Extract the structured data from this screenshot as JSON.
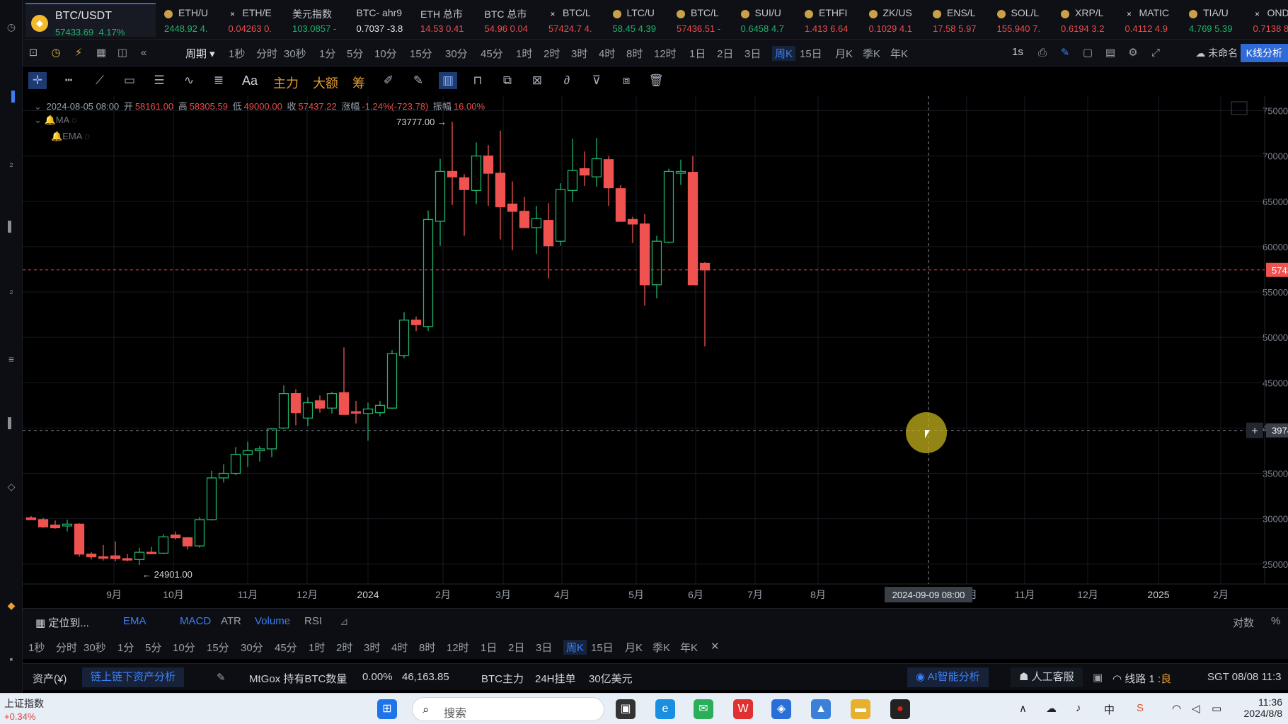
{
  "ticker": {
    "main": {
      "name": "BTC/USDT",
      "price": "57433.69",
      "change": "4.17%"
    },
    "items": [
      {
        "name": "ETH/U",
        "value": "2448.92",
        "change": "4.",
        "dir": "up",
        "icon": "coin-icon"
      },
      {
        "name": "ETH/E",
        "value": "0.04263",
        "change": "0.",
        "dir": "dn",
        "icon": "x-icon"
      },
      {
        "name": "美元指数",
        "value": "103.0857",
        "change": "-",
        "dir": "up",
        "icon": ""
      },
      {
        "name": "BTC- ahr9",
        "value": "0.7037",
        "change": "-3.8",
        "dir": "wh",
        "icon": ""
      },
      {
        "name": "ETH 总市",
        "value": "14.53",
        "change": "0.41",
        "dir": "dn",
        "icon": ""
      },
      {
        "name": "BTC 总市",
        "value": "54.96",
        "change": "0.04",
        "dir": "dn",
        "icon": ""
      },
      {
        "name": "BTC/L",
        "value": "57424.7",
        "change": "4.",
        "dir": "dn",
        "icon": "x-icon"
      },
      {
        "name": "LTC/U",
        "value": "58.45",
        "change": "4.39",
        "dir": "up",
        "icon": "coin-icon"
      },
      {
        "name": "BTC/L",
        "value": "57436.51",
        "change": "-",
        "dir": "dn",
        "icon": "coin-icon"
      },
      {
        "name": "SUI/U",
        "value": "0.6458",
        "change": "4.7",
        "dir": "up",
        "icon": "coin-icon"
      },
      {
        "name": "ETHFI",
        "value": "1.413",
        "change": "6.64",
        "dir": "dn",
        "icon": "coin-icon"
      },
      {
        "name": "ZK/US",
        "value": "0.1029",
        "change": "4.1",
        "dir": "dn",
        "icon": "coin-icon"
      },
      {
        "name": "ENS/L",
        "value": "17.58",
        "change": "5.97",
        "dir": "dn",
        "icon": "coin-icon"
      },
      {
        "name": "SOL/L",
        "value": "155.940",
        "change": "7.",
        "dir": "dn",
        "icon": "coin-icon"
      },
      {
        "name": "XRP/L",
        "value": "0.6194",
        "change": "3.2",
        "dir": "dn",
        "icon": "coin-icon"
      },
      {
        "name": "MATIC",
        "value": "0.4112",
        "change": "4.9",
        "dir": "dn",
        "icon": "x-icon"
      },
      {
        "name": "TIA/U",
        "value": "4.769",
        "change": "5.39",
        "dir": "up",
        "icon": "coin-icon"
      },
      {
        "name": "OND",
        "value": "0.7138",
        "change": "8.",
        "dir": "dn",
        "icon": "x-icon"
      }
    ]
  },
  "period_bar": {
    "period_label": "周期",
    "periods": [
      "1秒",
      "分时",
      "30秒",
      "1分",
      "5分",
      "10分",
      "15分",
      "30分",
      "45分",
      "1时",
      "2时",
      "3时",
      "4时",
      "8时",
      "12时",
      "1日",
      "2日",
      "3日",
      "周K",
      "15日",
      "月K",
      "季K",
      "年K"
    ],
    "active": "周K",
    "interval": "1s",
    "layout_name": "未命名",
    "k_button": "K线分析"
  },
  "draw_bar": {
    "text_tool": "Aa",
    "main_force": "主力",
    "large_order": "大额",
    "chips": "筹"
  },
  "info": {
    "date": "2024-08-05 08:00",
    "open_label": "开",
    "open": "58161.00",
    "high_label": "高",
    "high": "58305.59",
    "low_label": "低",
    "low": "49000.00",
    "close_label": "收",
    "close": "57437.22",
    "chg_label": "涨幅",
    "chg": "-1.24%(-723.78)",
    "amp_label": "振幅",
    "amp": "16.00%",
    "ind1": "MA",
    "ind2": "EMA"
  },
  "chart_data": {
    "type": "candlestick",
    "symbol": "BTC/USDT",
    "interval": "周K",
    "yaxis_ticks": [
      25000,
      30000,
      35000,
      40000,
      45000,
      50000,
      55000,
      60000,
      65000,
      70000,
      75000
    ],
    "ylim": [
      22500,
      77500
    ],
    "xaxis_labels": [
      "9月",
      "10月",
      "11月",
      "12月",
      "2024",
      "2月",
      "3月",
      "4月",
      "5月",
      "6月",
      "7月",
      "8月",
      "10月",
      "11月",
      "12月",
      "2025",
      "2月"
    ],
    "high_annotation": "73777.00",
    "low_annotation": "24901.00",
    "last_price_label": "5743",
    "crosshair_price_label": "3974",
    "crosshair_date_label": "2024-09-09 08:00",
    "candles": [
      {
        "o": 30100,
        "h": 30300,
        "l": 29900,
        "c": 29900
      },
      {
        "o": 29900,
        "h": 30100,
        "l": 29000,
        "c": 29100
      },
      {
        "o": 29300,
        "h": 29800,
        "l": 28900,
        "c": 29000
      },
      {
        "o": 29200,
        "h": 29900,
        "l": 28600,
        "c": 29400
      },
      {
        "o": 29400,
        "h": 29500,
        "l": 25800,
        "c": 26100
      },
      {
        "o": 26100,
        "h": 26300,
        "l": 25500,
        "c": 25800
      },
      {
        "o": 25800,
        "h": 27100,
        "l": 25400,
        "c": 25700
      },
      {
        "o": 25900,
        "h": 27500,
        "l": 25300,
        "c": 25600
      },
      {
        "o": 25600,
        "h": 26100,
        "l": 25300,
        "c": 25500
      },
      {
        "o": 25500,
        "h": 26800,
        "l": 24901,
        "c": 26300
      },
      {
        "o": 26300,
        "h": 26900,
        "l": 26100,
        "c": 26200
      },
      {
        "o": 26200,
        "h": 28300,
        "l": 26100,
        "c": 28000
      },
      {
        "o": 28200,
        "h": 28600,
        "l": 27700,
        "c": 27900
      },
      {
        "o": 27900,
        "h": 28000,
        "l": 26600,
        "c": 27000
      },
      {
        "o": 27000,
        "h": 30200,
        "l": 26800,
        "c": 29900
      },
      {
        "o": 29900,
        "h": 35300,
        "l": 29800,
        "c": 34500
      },
      {
        "o": 34500,
        "h": 36000,
        "l": 34000,
        "c": 35000
      },
      {
        "o": 35000,
        "h": 37900,
        "l": 34800,
        "c": 37100
      },
      {
        "o": 37100,
        "h": 38500,
        "l": 35700,
        "c": 37500
      },
      {
        "o": 37500,
        "h": 38000,
        "l": 36300,
        "c": 37700
      },
      {
        "o": 37700,
        "h": 40000,
        "l": 36800,
        "c": 39900
      },
      {
        "o": 40000,
        "h": 44700,
        "l": 39900,
        "c": 43800
      },
      {
        "o": 43800,
        "h": 44300,
        "l": 40300,
        "c": 41700
      },
      {
        "o": 41100,
        "h": 43400,
        "l": 40200,
        "c": 42800
      },
      {
        "o": 43000,
        "h": 43600,
        "l": 41700,
        "c": 42200
      },
      {
        "o": 42200,
        "h": 44000,
        "l": 41600,
        "c": 43800
      },
      {
        "o": 43900,
        "h": 48900,
        "l": 41500,
        "c": 41500
      },
      {
        "o": 41800,
        "h": 43000,
        "l": 40500,
        "c": 41700
      },
      {
        "o": 41600,
        "h": 42800,
        "l": 38600,
        "c": 42100
      },
      {
        "o": 41700,
        "h": 43000,
        "l": 41300,
        "c": 42500
      },
      {
        "o": 42200,
        "h": 48600,
        "l": 42100,
        "c": 48200
      },
      {
        "o": 48000,
        "h": 52800,
        "l": 47700,
        "c": 51900
      },
      {
        "o": 51900,
        "h": 52300,
        "l": 50700,
        "c": 51400
      },
      {
        "o": 51200,
        "h": 64000,
        "l": 50700,
        "c": 63000
      },
      {
        "o": 62800,
        "h": 69700,
        "l": 60100,
        "c": 68300
      },
      {
        "o": 68300,
        "h": 73777,
        "l": 64600,
        "c": 67700
      },
      {
        "o": 67600,
        "h": 68000,
        "l": 61200,
        "c": 66300
      },
      {
        "o": 66200,
        "h": 71500,
        "l": 64700,
        "c": 70000
      },
      {
        "o": 70000,
        "h": 71200,
        "l": 64500,
        "c": 68100
      },
      {
        "o": 68100,
        "h": 72800,
        "l": 60800,
        "c": 64400
      },
      {
        "o": 64700,
        "h": 67200,
        "l": 59600,
        "c": 63900
      },
      {
        "o": 63900,
        "h": 65500,
        "l": 62700,
        "c": 62100
      },
      {
        "o": 62100,
        "h": 64500,
        "l": 59200,
        "c": 63100
      },
      {
        "o": 62900,
        "h": 64800,
        "l": 56500,
        "c": 60100
      },
      {
        "o": 60600,
        "h": 67000,
        "l": 60100,
        "c": 66300
      },
      {
        "o": 66200,
        "h": 71900,
        "l": 65000,
        "c": 68400
      },
      {
        "o": 68600,
        "h": 70500,
        "l": 66700,
        "c": 67900
      },
      {
        "o": 67700,
        "h": 72000,
        "l": 66600,
        "c": 69700
      },
      {
        "o": 69600,
        "h": 70000,
        "l": 64500,
        "c": 66500
      },
      {
        "o": 66400,
        "h": 66800,
        "l": 63000,
        "c": 62800
      },
      {
        "o": 63000,
        "h": 63300,
        "l": 60400,
        "c": 62500
      },
      {
        "o": 62500,
        "h": 63600,
        "l": 53500,
        "c": 55800
      },
      {
        "o": 55800,
        "h": 61200,
        "l": 54300,
        "c": 60600
      },
      {
        "o": 60500,
        "h": 68600,
        "l": 60400,
        "c": 68300
      },
      {
        "o": 68100,
        "h": 69600,
        "l": 66800,
        "c": 68300
      },
      {
        "o": 68200,
        "h": 70000,
        "l": 65100,
        "c": 55800
      },
      {
        "o": 58161,
        "h": 58306,
        "l": 49000,
        "c": 57437
      }
    ]
  },
  "bottom_tabs": {
    "locate": "定位到...",
    "ema": "EMA",
    "macd": "MACD",
    "atr": "ATR",
    "volume": "Volume",
    "rsi": "RSI",
    "log": "对数",
    "pct": "%"
  },
  "bottom_periods": [
    "1秒",
    "分时",
    "30秒",
    "1分",
    "5分",
    "10分",
    "15分",
    "30分",
    "45分",
    "1时",
    "2时",
    "3时",
    "4时",
    "8时",
    "12时",
    "1日",
    "2日",
    "3日",
    "周K",
    "15日",
    "月K",
    "季K",
    "年K"
  ],
  "status": {
    "assets": "资产(¥)",
    "onchain_btn": "链上链下资产分析",
    "mtgox_label": "MtGox 持有BTC数量",
    "mtgox_pct": "0.00%",
    "mtgox_val": "46,163.85",
    "btc_main": "BTC主力",
    "pending": "24H挂单",
    "pending_val": "30亿美元",
    "ai_btn": "AI智能分析",
    "support": "人工客服",
    "line": "线路 1 :",
    "line_status": "良",
    "time": "SGT 08/08 11:3"
  },
  "taskbar": {
    "index_name": "上证指数",
    "index_change": "+0.34%",
    "search": "搜索",
    "clock_time": "11:36",
    "clock_date": "2024/8/8"
  }
}
